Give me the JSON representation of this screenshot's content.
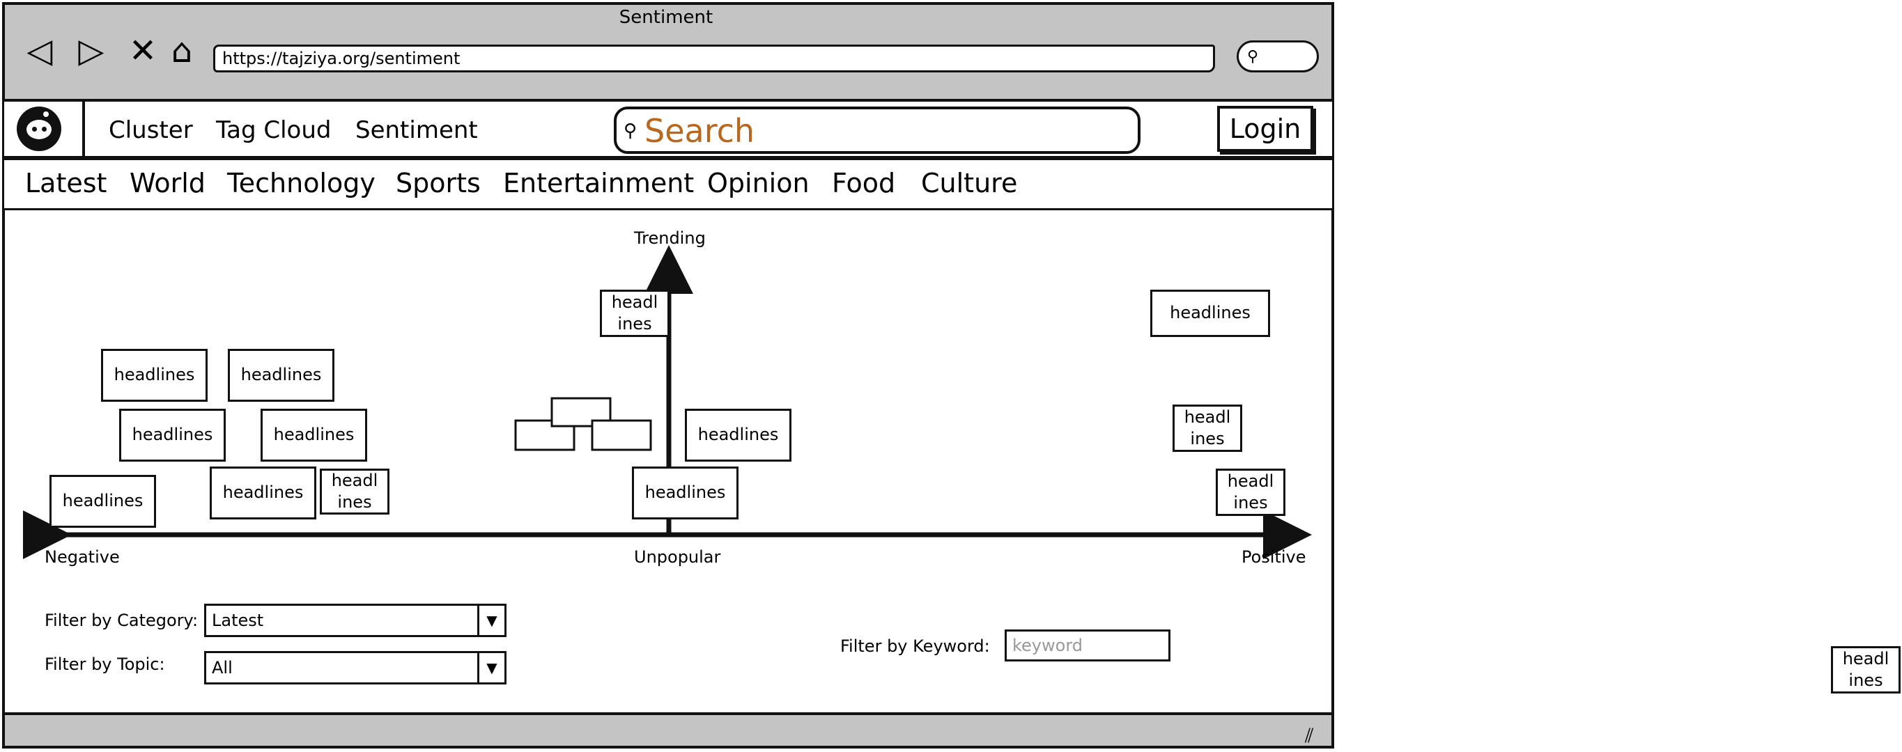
{
  "window": {
    "title": "Sentiment",
    "url": "https://tajziya.org/sentiment"
  },
  "icons": {
    "back": "◁",
    "forward": "▷",
    "close": "✕",
    "home": "⌂",
    "search": "⚲",
    "resize": "⫽"
  },
  "header": {
    "nav": [
      "Cluster",
      "Tag Cloud",
      "Sentiment"
    ],
    "search_placeholder": "Search",
    "login_label": "Login"
  },
  "categories": [
    "Latest",
    "World",
    "Technology",
    "Sports",
    "Entertainment",
    "Opinion",
    "Food",
    "Culture"
  ],
  "chart": {
    "y_top_label": "Trending",
    "x_left_label": "Negative",
    "x_center_label": "Unpopular",
    "x_right_label": "Positive",
    "headline_text": "headlines",
    "headline_text_narrow": "headl ines"
  },
  "filters": {
    "category_label": "Filter by Category:",
    "category_value": "Latest",
    "topic_label": "Filter by Topic:",
    "topic_value": "All",
    "keyword_label": "Filter by Keyword:",
    "keyword_placeholder": "keyword",
    "dropdown_arrow": "▼"
  }
}
